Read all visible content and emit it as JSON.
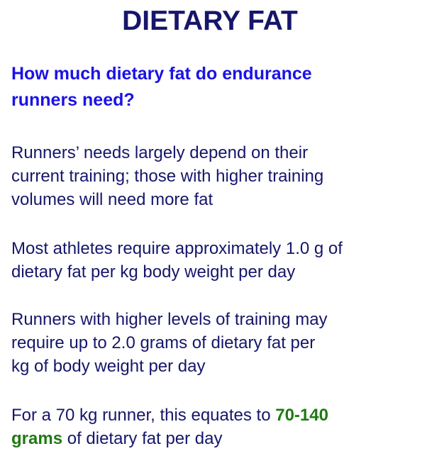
{
  "title": "DIETARY FAT",
  "question": {
    "line1": "How much dietary fat do endurance",
    "line2": "runners need?"
  },
  "paragraphs": {
    "p1": {
      "line1": "Runners’ needs largely depend on their",
      "line2": "current training; those with higher training",
      "line3": "volumes will need more fat"
    },
    "p2": {
      "line1": "Most athletes require approximately 1.0 g of",
      "line2": "dietary fat per kg body weight per day"
    },
    "p3": {
      "line1": "Runners with higher levels of training may",
      "line2": "require up to 2.0 grams of dietary fat per",
      "line3": "kg of body weight per day"
    },
    "p4": {
      "line1_text": "For a 70 kg runner, this equates to ",
      "line1_highlight": "70-140",
      "line2_highlight": "grams",
      "line2_text": " of dietary fat per day"
    }
  },
  "colors": {
    "title": "#16166b",
    "question": "#1a12e6",
    "body": "#16166b",
    "highlight": "#1f7a12"
  }
}
